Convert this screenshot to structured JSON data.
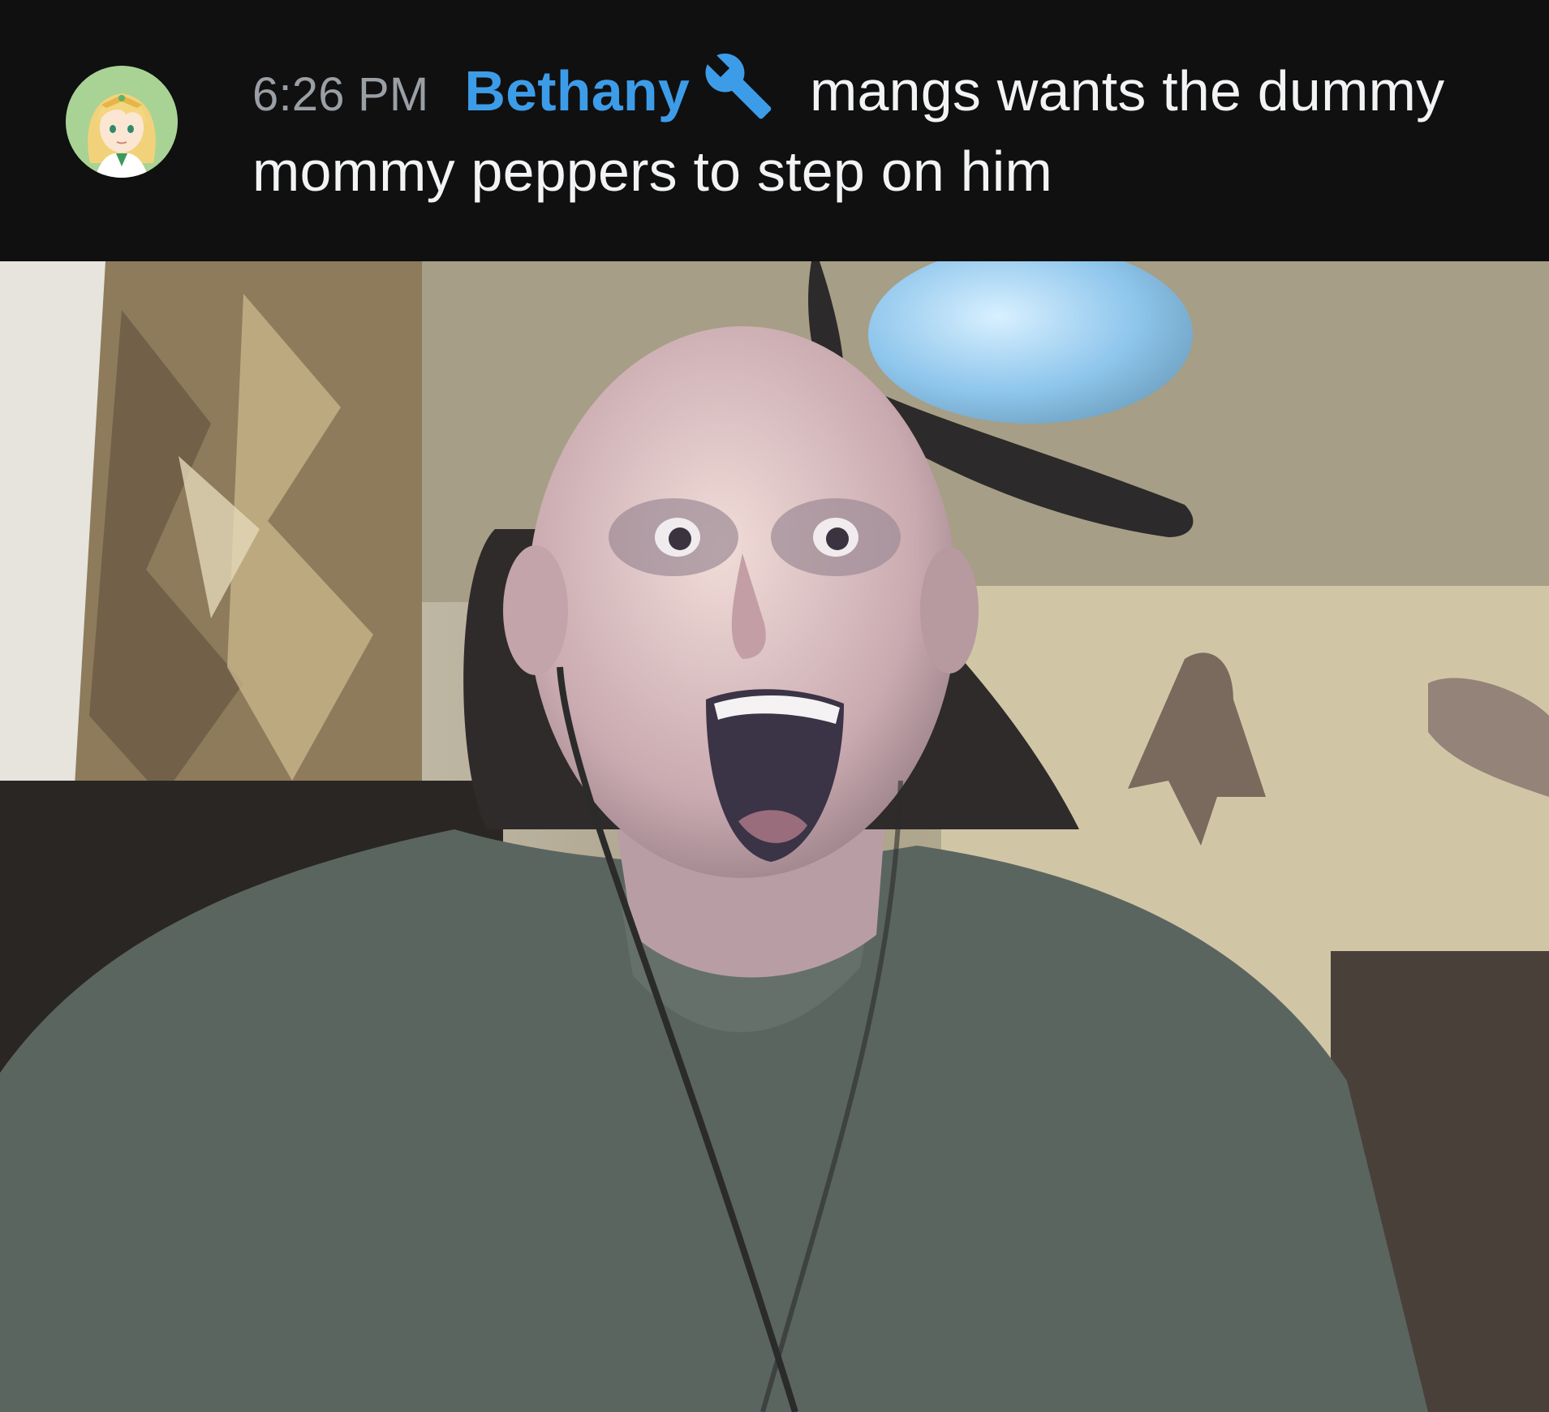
{
  "message": {
    "timestamp": "6:26 PM",
    "username": "Bethany",
    "username_color": "#3d9ce8",
    "role_icon": "wrench-icon",
    "role_icon_color": "#3d9ce8",
    "text": "mangs wants the dummy mommy peppers to step on him",
    "avatar": "anime-avatar-icon"
  },
  "embed": {
    "type": "photo",
    "subject": "surprised-bald-man-photo"
  },
  "colors": {
    "background": "#101010",
    "text": "#f2f3f5",
    "timestamp": "#9a9ea5"
  }
}
